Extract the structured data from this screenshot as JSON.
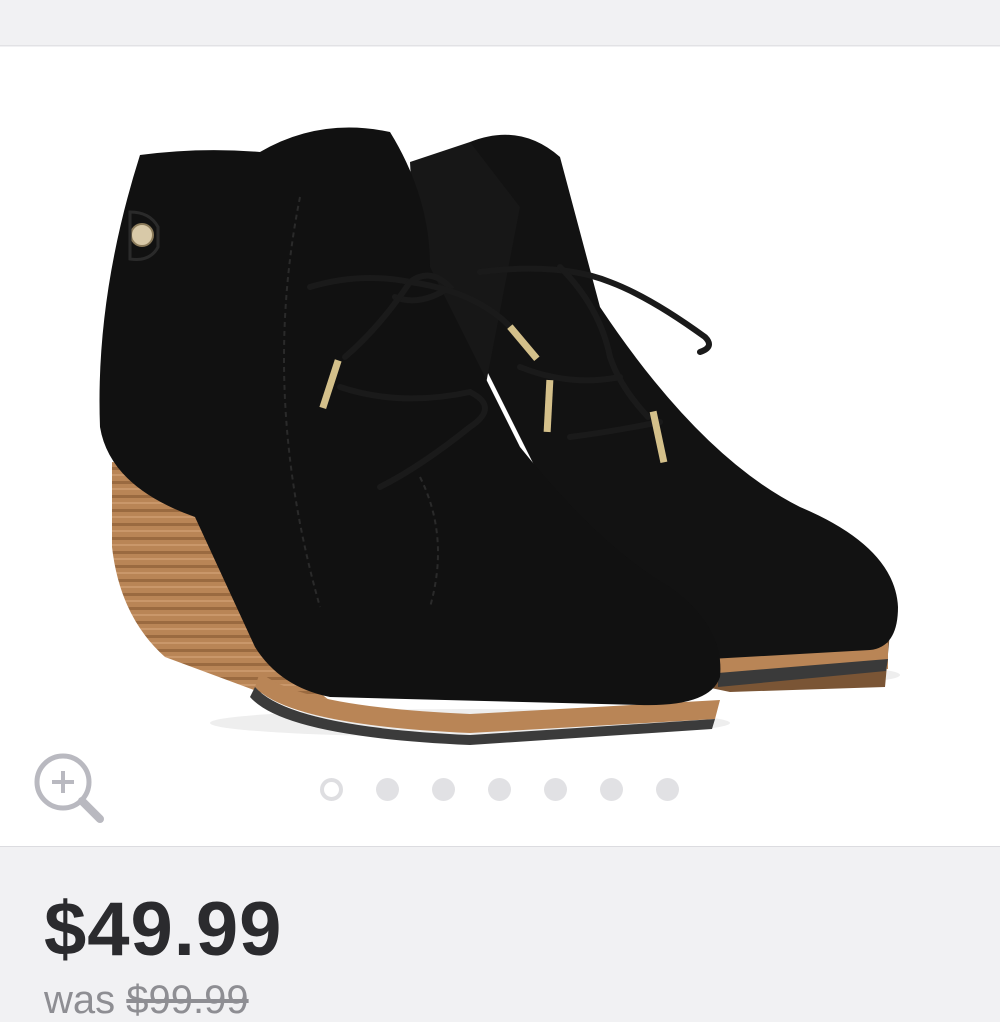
{
  "product": {
    "name": "Black lace-up wedge ankle boots",
    "image_alt": "Black lace-up wedge ankle booties"
  },
  "gallery": {
    "zoom_icon": "zoom-in-icon",
    "page_count": 7,
    "active_index": 0
  },
  "pricing": {
    "price": "$49.99",
    "was_label": "was",
    "was_price": "$99.99"
  },
  "colors": {
    "page_bg": "#f1f1f3",
    "gallery_bg": "#ffffff",
    "price_text": "#2b2b2e",
    "was_text": "#8e8e93",
    "dot_inactive": "#e1e1e4"
  }
}
